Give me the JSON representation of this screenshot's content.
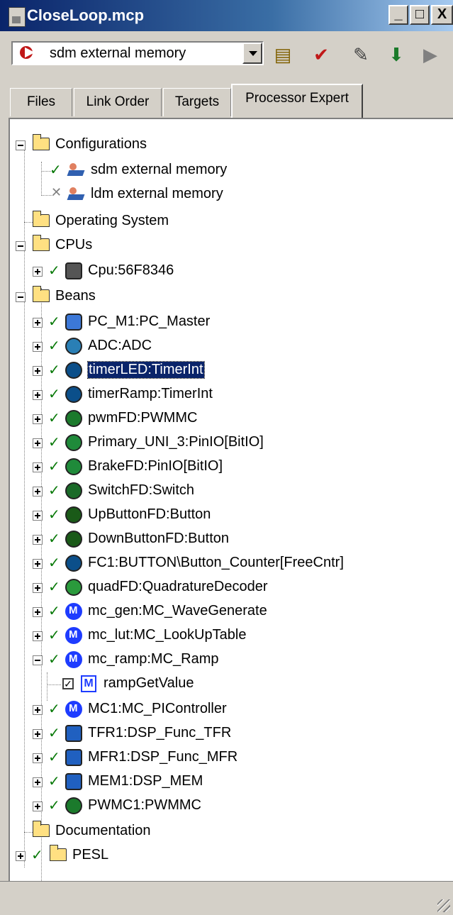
{
  "window": {
    "title": "CloseLoop.mcp",
    "buttons": [
      "_",
      "□",
      "X"
    ]
  },
  "toolbar": {
    "target_value": "sdm external memory"
  },
  "tabs": [
    {
      "label": "Files",
      "active": false
    },
    {
      "label": "Link Order",
      "active": false
    },
    {
      "label": "Targets",
      "active": false
    },
    {
      "label": "Processor Expert",
      "active": true
    }
  ],
  "tree": {
    "configurations": "Configurations",
    "cfg_sdm": "sdm external memory",
    "cfg_ldm": "ldm external memory",
    "operating_system": "Operating System",
    "cpus": "CPUs",
    "cpu": "Cpu:56F8346",
    "beans": "Beans",
    "bean_items": [
      "PC_M1:PC_Master",
      "ADC:ADC",
      "timerLED:TimerInt",
      "timerRamp:TimerInt",
      "pwmFD:PWMMC",
      "Primary_UNI_3:PinIO[BitIO]",
      "BrakeFD:PinIO[BitIO]",
      "SwitchFD:Switch",
      "UpButtonFD:Button",
      "DownButtonFD:Button",
      "FC1:BUTTON\\Button_Counter[FreeCntr]",
      "quadFD:QuadratureDecoder",
      "mc_gen:MC_WaveGenerate",
      "mc_lut:MC_LookUpTable",
      "mc_ramp:MC_Ramp"
    ],
    "ramp_method": "rampGetValue",
    "bean_items_2": [
      "MC1:MC_PIController",
      "TFR1:DSP_Func_TFR",
      "MFR1:DSP_Func_MFR",
      "MEM1:DSP_MEM",
      "PWMC1:PWMMC"
    ],
    "documentation": "Documentation",
    "pesl": "PESL"
  }
}
